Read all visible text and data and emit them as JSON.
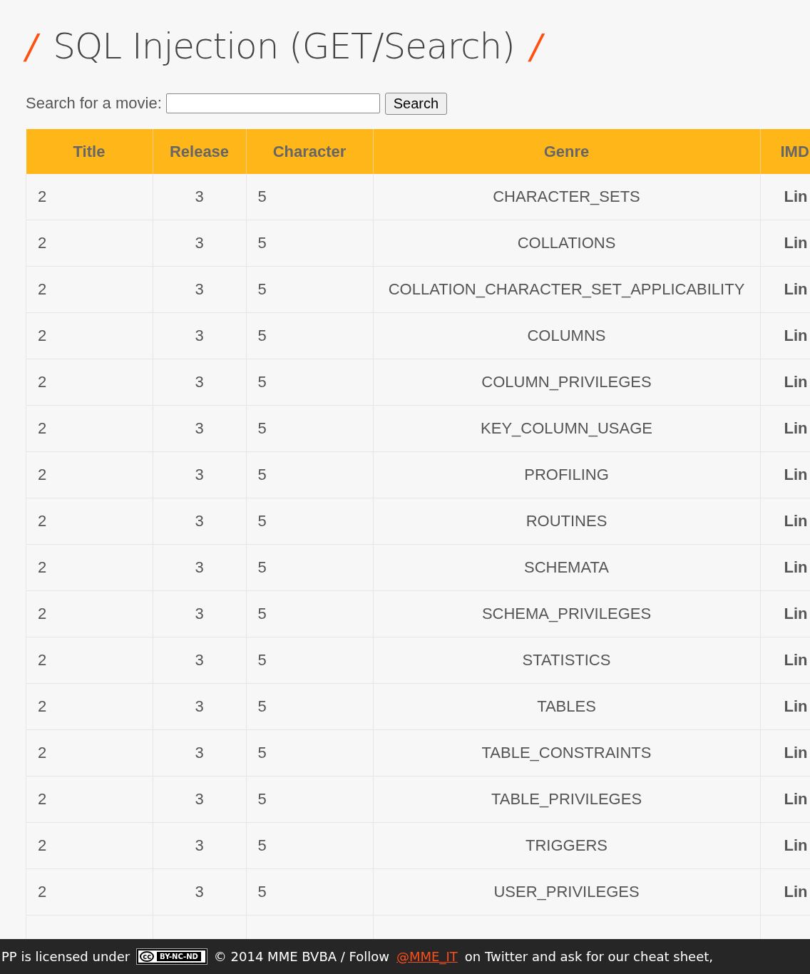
{
  "page_title": {
    "slash_left": "/",
    "text": "SQL Injection (GET/Search)",
    "slash_right": "/"
  },
  "search": {
    "label": "Search for a movie:",
    "button": "Search"
  },
  "table": {
    "columns": [
      "Title",
      "Release",
      "Character",
      "Genre",
      "IMD"
    ],
    "rows": [
      {
        "title": "2",
        "release": "3",
        "character": "5",
        "genre": "CHARACTER_SETS",
        "imdb": "Lin"
      },
      {
        "title": "2",
        "release": "3",
        "character": "5",
        "genre": "COLLATIONS",
        "imdb": "Lin"
      },
      {
        "title": "2",
        "release": "3",
        "character": "5",
        "genre": "COLLATION_CHARACTER_SET_APPLICABILITY",
        "imdb": "Lin"
      },
      {
        "title": "2",
        "release": "3",
        "character": "5",
        "genre": "COLUMNS",
        "imdb": "Lin"
      },
      {
        "title": "2",
        "release": "3",
        "character": "5",
        "genre": "COLUMN_PRIVILEGES",
        "imdb": "Lin"
      },
      {
        "title": "2",
        "release": "3",
        "character": "5",
        "genre": "KEY_COLUMN_USAGE",
        "imdb": "Lin"
      },
      {
        "title": "2",
        "release": "3",
        "character": "5",
        "genre": "PROFILING",
        "imdb": "Lin"
      },
      {
        "title": "2",
        "release": "3",
        "character": "5",
        "genre": "ROUTINES",
        "imdb": "Lin"
      },
      {
        "title": "2",
        "release": "3",
        "character": "5",
        "genre": "SCHEMATA",
        "imdb": "Lin"
      },
      {
        "title": "2",
        "release": "3",
        "character": "5",
        "genre": "SCHEMA_PRIVILEGES",
        "imdb": "Lin"
      },
      {
        "title": "2",
        "release": "3",
        "character": "5",
        "genre": "STATISTICS",
        "imdb": "Lin"
      },
      {
        "title": "2",
        "release": "3",
        "character": "5",
        "genre": "TABLES",
        "imdb": "Lin"
      },
      {
        "title": "2",
        "release": "3",
        "character": "5",
        "genre": "TABLE_CONSTRAINTS",
        "imdb": "Lin"
      },
      {
        "title": "2",
        "release": "3",
        "character": "5",
        "genre": "TABLE_PRIVILEGES",
        "imdb": "Lin"
      },
      {
        "title": "2",
        "release": "3",
        "character": "5",
        "genre": "TRIGGERS",
        "imdb": "Lin"
      },
      {
        "title": "2",
        "release": "3",
        "character": "5",
        "genre": "USER_PRIVILEGES",
        "imdb": "Lin"
      }
    ]
  },
  "footer": {
    "text_before": "PP is licensed under",
    "license_badge": {
      "symbol": "cc",
      "label": "BY-NC-ND"
    },
    "text_middle": "© 2014 MME BVBA / Follow",
    "link": "@MME_IT",
    "text_after": "on Twitter and ask for our cheat sheet,"
  }
}
